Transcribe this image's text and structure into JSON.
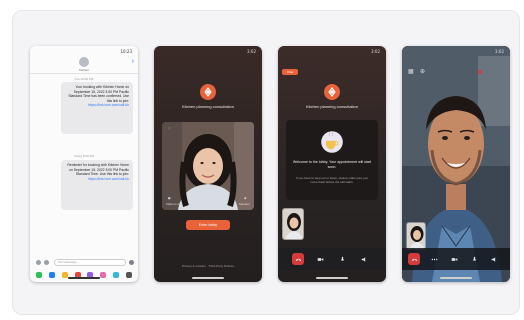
{
  "phones": {
    "messages": {
      "status_time": "10:23",
      "contact_name": "Kitchen",
      "timestamps": [
        "Tue 10:00 PM",
        "Today 8:00 AM"
      ],
      "bubble1": {
        "text": "Your booking with Kitchen Home on September 15, 2022 3:00 PM Pacific Standard Time has been confirmed. Use this link to join:",
        "link": "https://link.hcm.com/call-kh"
      },
      "bubble2": {
        "text": "Reminder for booking with Kitchen Home on September 15, 2022 3:00 PM Pacific Standard Time. Use this link to join:",
        "link": "https://link.hcm.com/call-kh"
      },
      "input_placeholder": "Text Message"
    },
    "lobby": {
      "status_time": "3:02",
      "title": "Kitchen planning consultation",
      "mic_label": "Mic is on",
      "speaker_label": "Speaker",
      "video_label": "Video is on",
      "join_label": "Enter lobby",
      "footer": "Privacy & cookies · Third-Party Notices"
    },
    "waiting": {
      "status_time": "3:02",
      "badge": "Chat",
      "title": "Kitchen planning consultation",
      "welcome": "Welcome to the lobby. Your appointment will start soon.",
      "welcome_sub": "If you have to step out or leave, please make sure you come back before the call starts."
    },
    "call": {
      "status_time": "3:02"
    }
  },
  "colors": {
    "accent": "#e8623a",
    "end_call": "#d63a3a",
    "link": "#2f7cf6"
  }
}
